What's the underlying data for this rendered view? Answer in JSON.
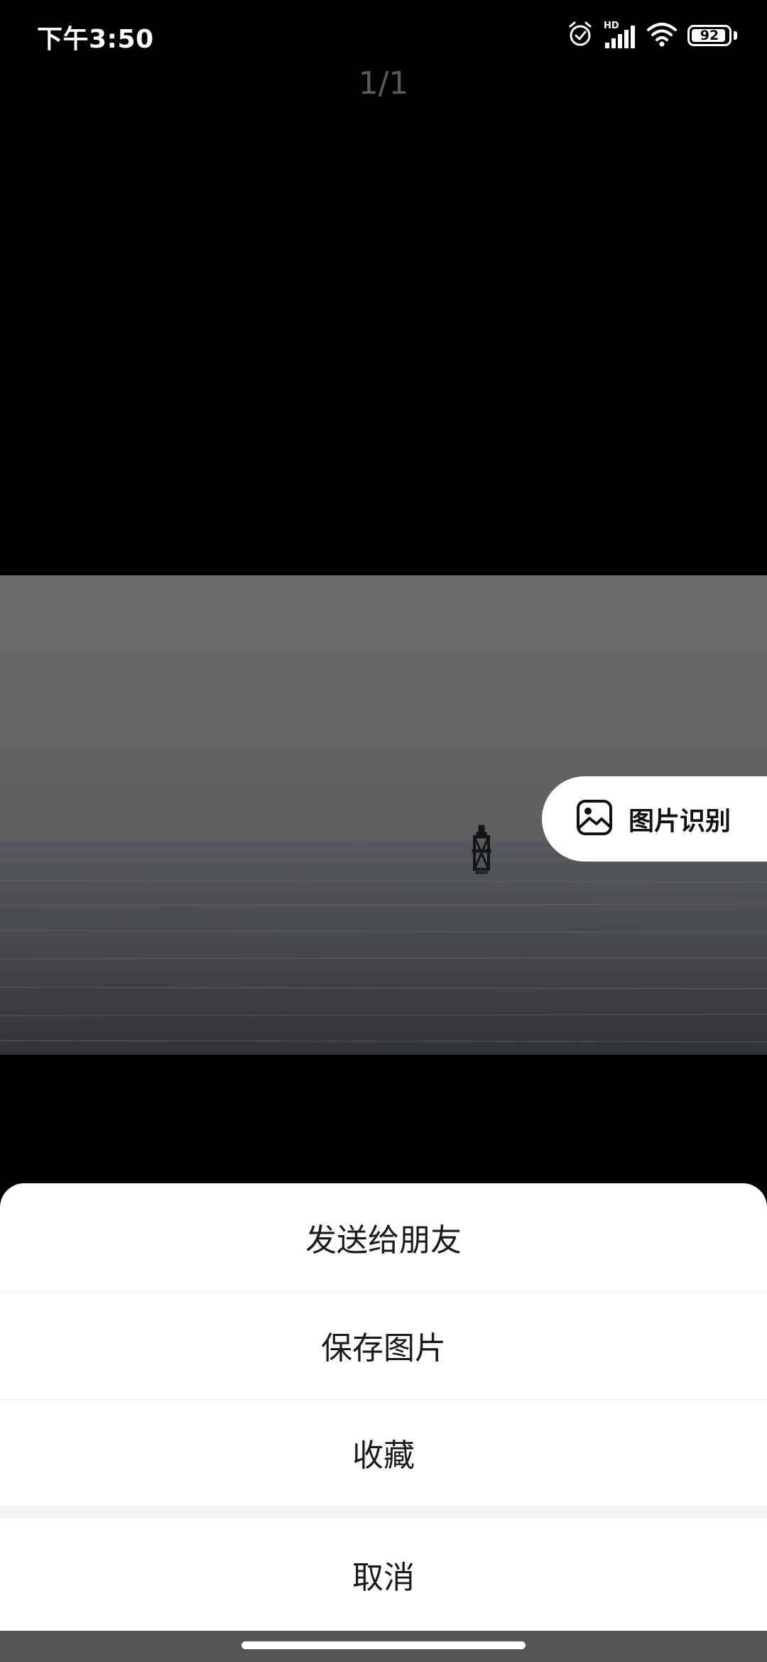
{
  "status_bar": {
    "time": "下午3:50",
    "network_label": "HD",
    "battery_level": "92"
  },
  "viewer": {
    "page_counter": "1/1"
  },
  "recognition_button": {
    "label": "图片识别",
    "icon": "image-icon"
  },
  "action_sheet": {
    "items": [
      {
        "label": "发送给朋友"
      },
      {
        "label": "保存图片"
      },
      {
        "label": "收藏"
      }
    ],
    "cancel_label": "取消"
  },
  "colors": {
    "background": "#000000",
    "sheet_background": "#ffffff",
    "pill_background": "#ffffff",
    "text_primary": "#1a1a1a",
    "counter_text": "#5a5a5a"
  }
}
